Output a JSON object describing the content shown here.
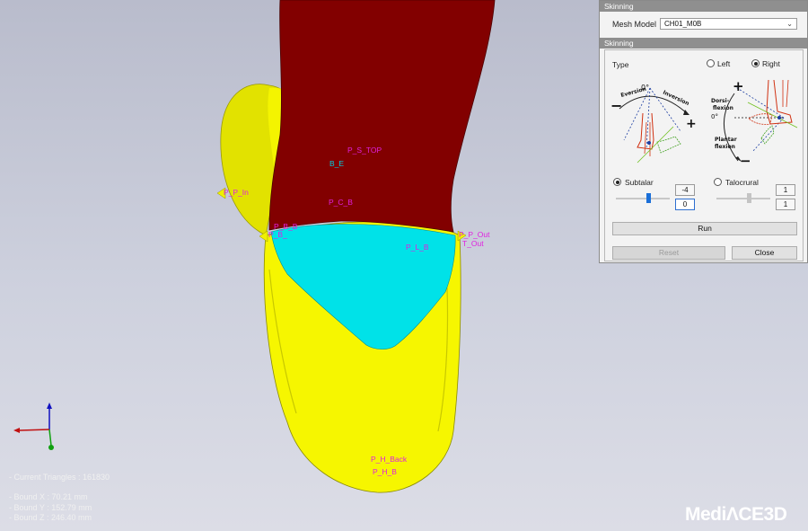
{
  "viewport": {
    "landmarks": [
      {
        "text": "P_S_TOP",
        "color": "magenta"
      },
      {
        "text": "B_E",
        "color": "cyan"
      },
      {
        "text": "P_P_In",
        "color": "magenta"
      },
      {
        "text": "P_C_B",
        "color": "magenta"
      },
      {
        "text": "P_B_B",
        "color": "magenta"
      },
      {
        "text": "P_B_",
        "color": "magenta"
      },
      {
        "text": "P_P_Out",
        "color": "magenta"
      },
      {
        "text": "T_Out",
        "color": "magenta"
      },
      {
        "text": "P_L_B",
        "color": "magenta"
      },
      {
        "text": "P_H_Back",
        "color": "magenta"
      },
      {
        "text": "P_H_B",
        "color": "magenta"
      }
    ],
    "stats": {
      "triangles": "- Current Triangles : 161830",
      "bound_x": "- Bound X : 70.21 mm",
      "bound_y": "- Bound Y : 152.79 mm",
      "bound_z": "- Bound Z : 246.40 mm"
    },
    "brand_left": "Medi",
    "brand_right": "CE3D",
    "colors": {
      "shin": "#800000",
      "cyan": "#00e1e6",
      "yellow": "#ffff00"
    }
  },
  "panel": {
    "title": "Skinning",
    "mesh_model_label": "Mesh Model",
    "mesh_model_value": "CH01_M0B",
    "section_title": "Skinning",
    "type_label": "Type",
    "left_label": "Left",
    "right_label": "Right",
    "selected_side": "Right",
    "diagram_left": {
      "zero": "0°",
      "eversion": "Eversion",
      "inversion": "Inversion",
      "minus": "−",
      "plus": "+"
    },
    "diagram_right": {
      "plus": "+",
      "dorsi": "Dorsi-",
      "flexion1": "flexion",
      "zero": "0°",
      "plantar": "Plantar",
      "flexion2": "flexion",
      "minus": "−"
    },
    "subtalar_label": "Subtalar",
    "subtalar_value": "-4",
    "subtalar_input": "0",
    "talocrural_label": "Talocrural",
    "talocrural_value": "1",
    "talocrural_input": "1",
    "selected_joint": "Subtalar",
    "run_label": "Run",
    "reset_label": "Reset",
    "close_label": "Close"
  }
}
